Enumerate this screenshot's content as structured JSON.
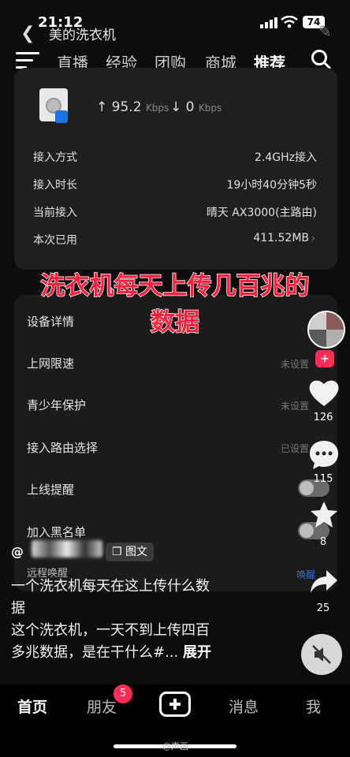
{
  "status_bar": {
    "time": "21:12",
    "battery": "74"
  },
  "header": {
    "app_title": "美的洗衣机"
  },
  "top_tabs": [
    {
      "label": "直播",
      "active": false
    },
    {
      "label": "经验",
      "active": false
    },
    {
      "label": "团购",
      "active": false
    },
    {
      "label": "商城",
      "active": false
    },
    {
      "label": "推荐",
      "active": true
    }
  ],
  "device_card": {
    "upload_speed": "95.2",
    "upload_unit": "Kbps",
    "download_speed": "0",
    "download_unit": "Kbps",
    "rows": [
      {
        "label": "接入方式",
        "value": "2.4GHz接入"
      },
      {
        "label": "接入时长",
        "value": "19小时40分钟5秒"
      },
      {
        "label": "当前接入",
        "value": "晴天 AX3000(主路由)"
      },
      {
        "label": "本次已用",
        "value": "411.52MB"
      }
    ]
  },
  "overlay_title": {
    "line1": "洗衣机每天上传几百兆的",
    "line2": "数据"
  },
  "settings_card": {
    "items": [
      {
        "label": "设备详情",
        "value": ""
      },
      {
        "label": "上网限速",
        "value": "未设置"
      },
      {
        "label": "青少年保护",
        "value": "未设置"
      },
      {
        "label": "接入路由选择",
        "value": "已设置"
      },
      {
        "label": "上线提醒",
        "value": ""
      },
      {
        "label": "加入黑名单",
        "value": ""
      },
      {
        "label": "远程唤醒",
        "value": "唤醒"
      }
    ]
  },
  "actions": {
    "follow_label": "+",
    "like_count": "126",
    "comment_count": "115",
    "favorite_count": "8",
    "share_count": "25"
  },
  "post": {
    "author_prefix": "@",
    "tag_label": "图文",
    "caption_line1": "一个洗衣机每天在这上传什么数",
    "caption_line2": "据",
    "caption_line3": "这个洗衣机，一天不到上传四百",
    "caption_line4": "多兆数据，是在干什么#...",
    "expand_label": "展开"
  },
  "bottom_nav": {
    "home": "首页",
    "friends": "朋友",
    "friends_badge": "5",
    "messages": "消息",
    "me": "我"
  },
  "watermark": "@声画"
}
